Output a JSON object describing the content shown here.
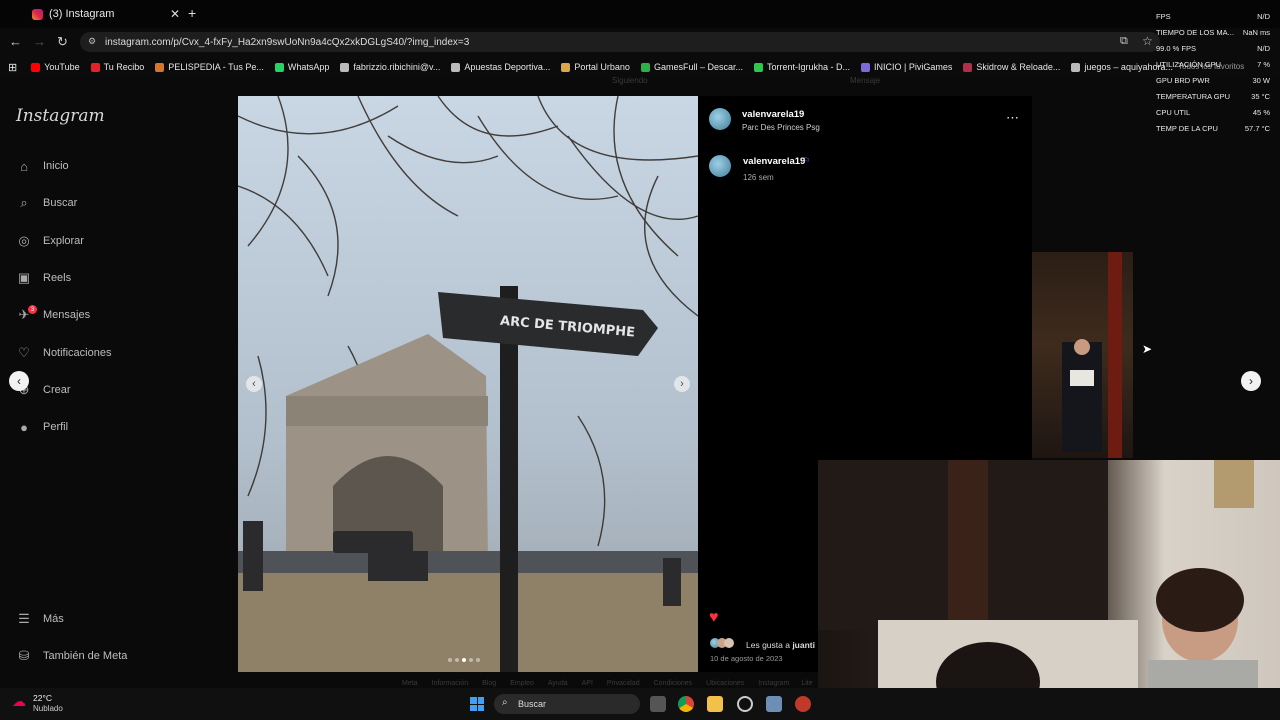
{
  "browser": {
    "tab_title": "(3) Instagram",
    "url": "instagram.com/p/Cvx_4-fxFy_Ha2xn9swUoNn9a4cQx2xkDGLgS40/?img_index=3",
    "bookmarks": [
      "YouTube",
      "Tu Recibo",
      "PELISPEDIA - Tus Pe...",
      "WhatsApp",
      "fabrizzio.ribichini@v...",
      "Apuestas Deportiva...",
      "Portal Urbano",
      "GamesFull – Descar...",
      "Torrent-Igrukha - D...",
      "INICIO | PiviGames",
      "Skidrow & Reloade...",
      "juegos – aquiyahora..."
    ],
    "bookmark_colors": [
      "#ff0000",
      "#e0222b",
      "#d4762d",
      "#25d366",
      "#bbbbbb",
      "#bbbbbb",
      "#d9a84a",
      "#2fae4e",
      "#2cc84a",
      "#7a6bd8",
      "#b0304a",
      "#bbbbbb"
    ],
    "favorites_label": "Todos los favoritos"
  },
  "stats": [
    {
      "label": "FPS",
      "value": "N/D"
    },
    {
      "label": "TIEMPO DE LOS MA...",
      "value": "NaN ms"
    },
    {
      "label": "99.0 % FPS",
      "value": "N/D"
    },
    {
      "label": "UTILIZACIÓN GPU",
      "value": "7 %"
    },
    {
      "label": "GPU BRD PWR",
      "value": "30 W"
    },
    {
      "label": "TEMPERATURA GPU",
      "value": "35 °C"
    },
    {
      "label": "CPU UTIL",
      "value": "45 %"
    },
    {
      "label": "TEMP DE LA CPU",
      "value": "57.7 °C"
    }
  ],
  "instagram": {
    "logo": "Instagram",
    "nav": [
      {
        "label": "Inicio",
        "icon": "home-icon",
        "glyph": "⌂"
      },
      {
        "label": "Buscar",
        "icon": "search-icon",
        "glyph": "⌕"
      },
      {
        "label": "Explorar",
        "icon": "compass-icon",
        "glyph": "◎"
      },
      {
        "label": "Reels",
        "icon": "reels-icon",
        "glyph": "▣"
      },
      {
        "label": "Mensajes",
        "icon": "messenger-icon",
        "glyph": "✈"
      },
      {
        "label": "Notificaciones",
        "icon": "heart-icon",
        "glyph": "♡"
      },
      {
        "label": "Crear",
        "icon": "plus-icon",
        "glyph": "⊕"
      },
      {
        "label": "Perfil",
        "icon": "profile-avatar-icon",
        "glyph": "●"
      }
    ],
    "messages_badge": "3",
    "more_label": "Más",
    "meta_label": "También de Meta",
    "background_labels": {
      "following": "Siguiendo",
      "message": "Mensaje"
    }
  },
  "post": {
    "username": "valenvarela19",
    "location": "Parc Des Princes Psg",
    "caption_time": "126 sem",
    "sign_text": "ARC DE TRIOMPHE",
    "likes_prefix": "Les gusta a ",
    "likes_user": "juanti",
    "date": "10 de agosto de 2023",
    "carousel_dots": 5,
    "carousel_active": 3
  },
  "footer_links": [
    "Meta",
    "Información",
    "Blog",
    "Empleo",
    "Ayuda",
    "API",
    "Privacidad",
    "Condiciones",
    "Ubicaciones",
    "Instagram Lite"
  ],
  "taskbar": {
    "weather_temp": "22°C",
    "weather_desc": "Nublado",
    "search_label": "Buscar"
  }
}
